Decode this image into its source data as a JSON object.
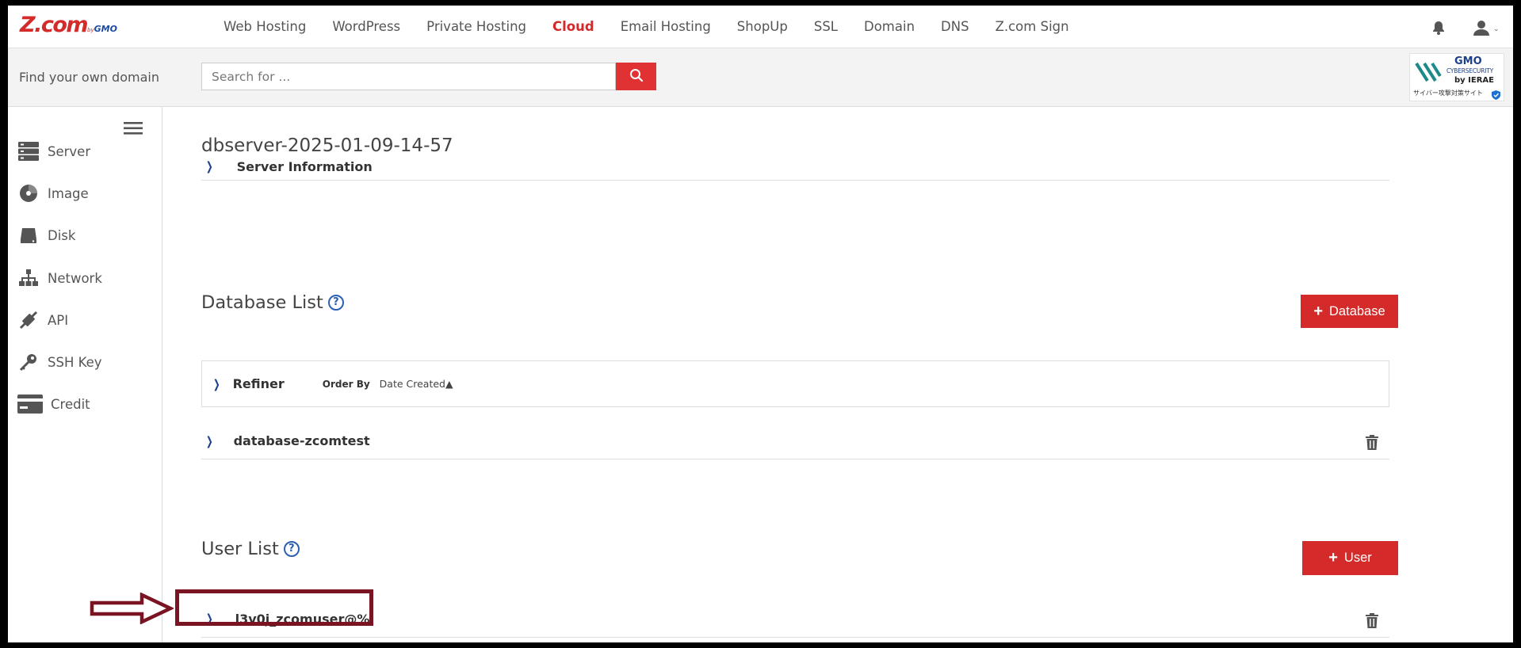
{
  "brand": {
    "logo_main": "Z.com",
    "logo_by": "by",
    "logo_gmo": "GMO"
  },
  "nav": {
    "links": [
      "Web Hosting",
      "WordPress",
      "Private Hosting",
      "Cloud",
      "Email Hosting",
      "ShopUp",
      "SSL",
      "Domain",
      "DNS",
      "Z.com Sign"
    ],
    "active": "Cloud"
  },
  "search": {
    "label": "Find your own domain",
    "placeholder": "Search for ..."
  },
  "badge": {
    "gmo": "GMO",
    "line1": "CYBERSECURITY",
    "line2": "by IERAE",
    "line3": "サイバー攻撃対策サイト"
  },
  "sidebar": {
    "items": [
      {
        "label": "Server",
        "icon": "server-icon"
      },
      {
        "label": "Image",
        "icon": "image-icon"
      },
      {
        "label": "Disk",
        "icon": "disk-icon"
      },
      {
        "label": "Network",
        "icon": "network-icon"
      },
      {
        "label": "API",
        "icon": "api-icon"
      },
      {
        "label": "SSH Key",
        "icon": "key-icon"
      },
      {
        "label": "Credit",
        "icon": "credit-card-icon"
      }
    ]
  },
  "main": {
    "server_title": "dbserver-2025-01-09-14-57",
    "server_info_label": "Server Information",
    "database_section": {
      "title": "Database List",
      "add_button": "Database",
      "refiner_label": "Refiner",
      "order_by_label": "Order By",
      "order_by_value": "Date Created▲",
      "items": [
        "database-zcomtest"
      ]
    },
    "user_section": {
      "title": "User List",
      "add_button": "User",
      "items": [
        "l3v0j_zcomuser@%"
      ]
    }
  },
  "colors": {
    "accent_red": "#d42a2a",
    "chevron_blue": "#1b3f8b",
    "highlight": "#7b1422"
  }
}
